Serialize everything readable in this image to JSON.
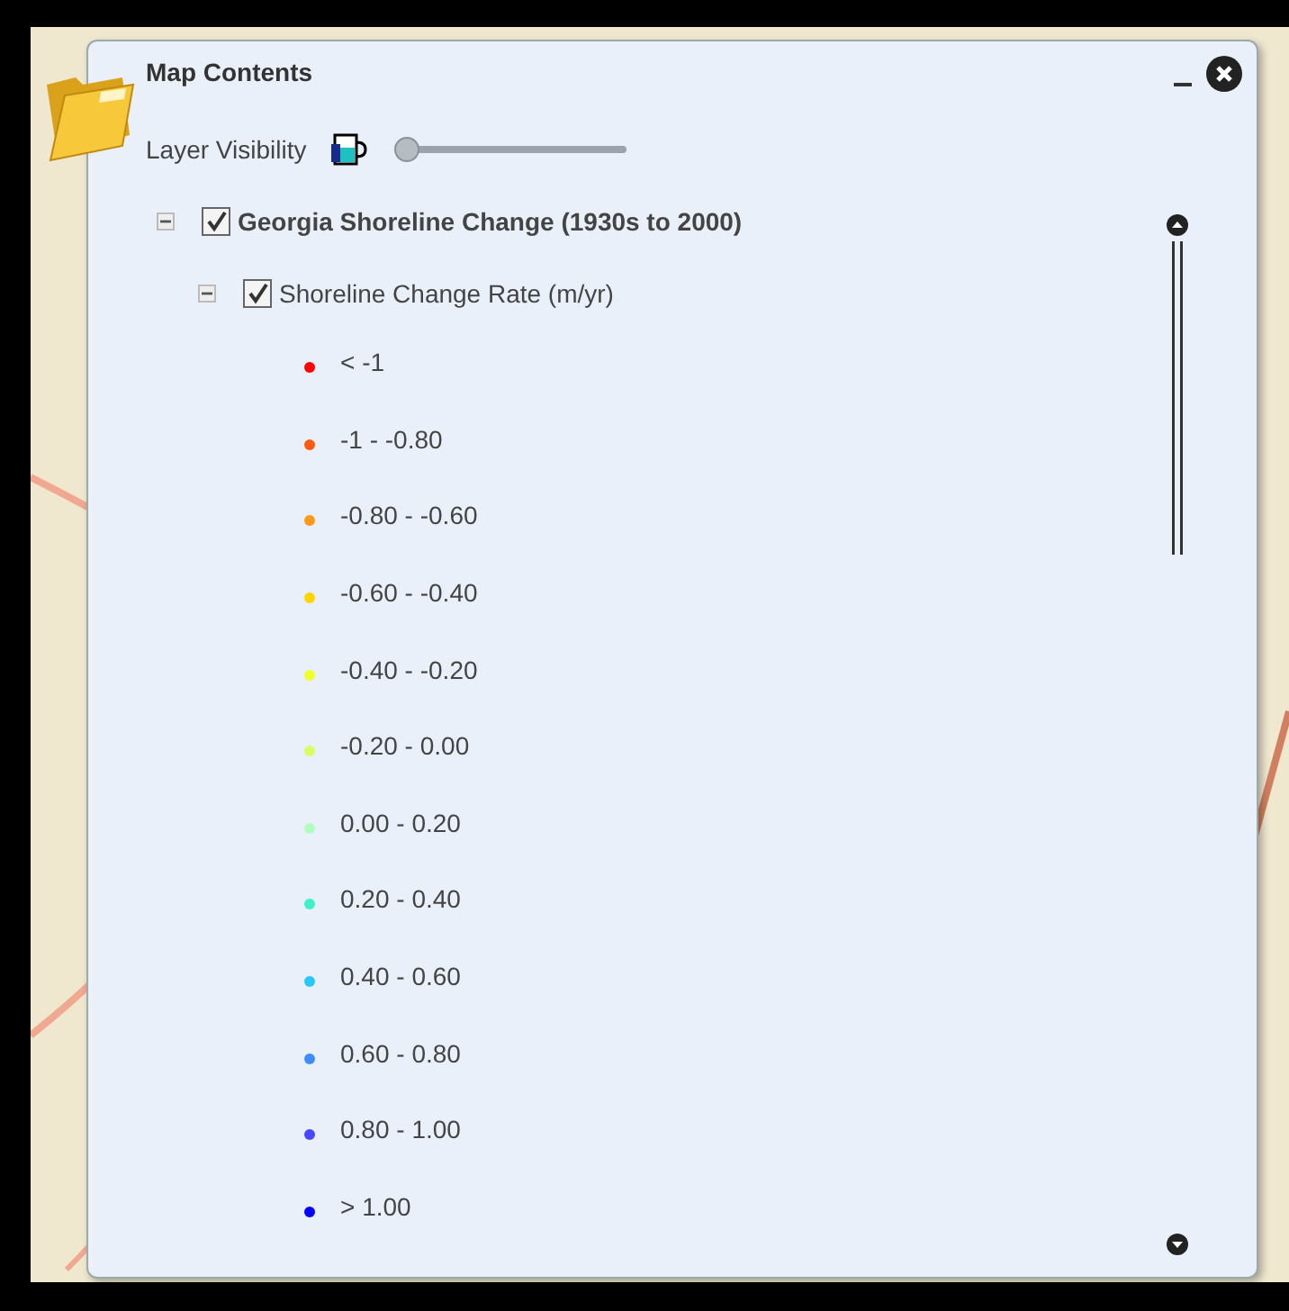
{
  "window": {
    "title": "Map Contents"
  },
  "layer_visibility": {
    "label": "Layer Visibility",
    "level": 0.02
  },
  "layers": [
    {
      "name": "Georgia Shoreline Change (1930s to 2000)",
      "checked": true,
      "expanded": true,
      "children": [
        {
          "name": "Shoreline Change Rate (m/yr)",
          "checked": true,
          "expanded": true,
          "legend": [
            {
              "label": "< -1",
              "color": "#ff0000"
            },
            {
              "label": "-1 - -0.80",
              "color": "#ff5a14"
            },
            {
              "label": "-0.80 - -0.60",
              "color": "#ff9a14"
            },
            {
              "label": "-0.60 - -0.40",
              "color": "#ffd400"
            },
            {
              "label": "-0.40 - -0.20",
              "color": "#f0ff2a"
            },
            {
              "label": "-0.20 - 0.00",
              "color": "#d8ff66"
            },
            {
              "label": "0.00 - 0.20",
              "color": "#b0ffc0"
            },
            {
              "label": "0.20 - 0.40",
              "color": "#40f0c8"
            },
            {
              "label": "0.40 - 0.60",
              "color": "#28c8ff"
            },
            {
              "label": "0.60 - 0.80",
              "color": "#3c8cff"
            },
            {
              "label": "0.80 - 1.00",
              "color": "#4848ff"
            },
            {
              "label": "> 1.00",
              "color": "#0000ff"
            }
          ]
        }
      ]
    }
  ]
}
